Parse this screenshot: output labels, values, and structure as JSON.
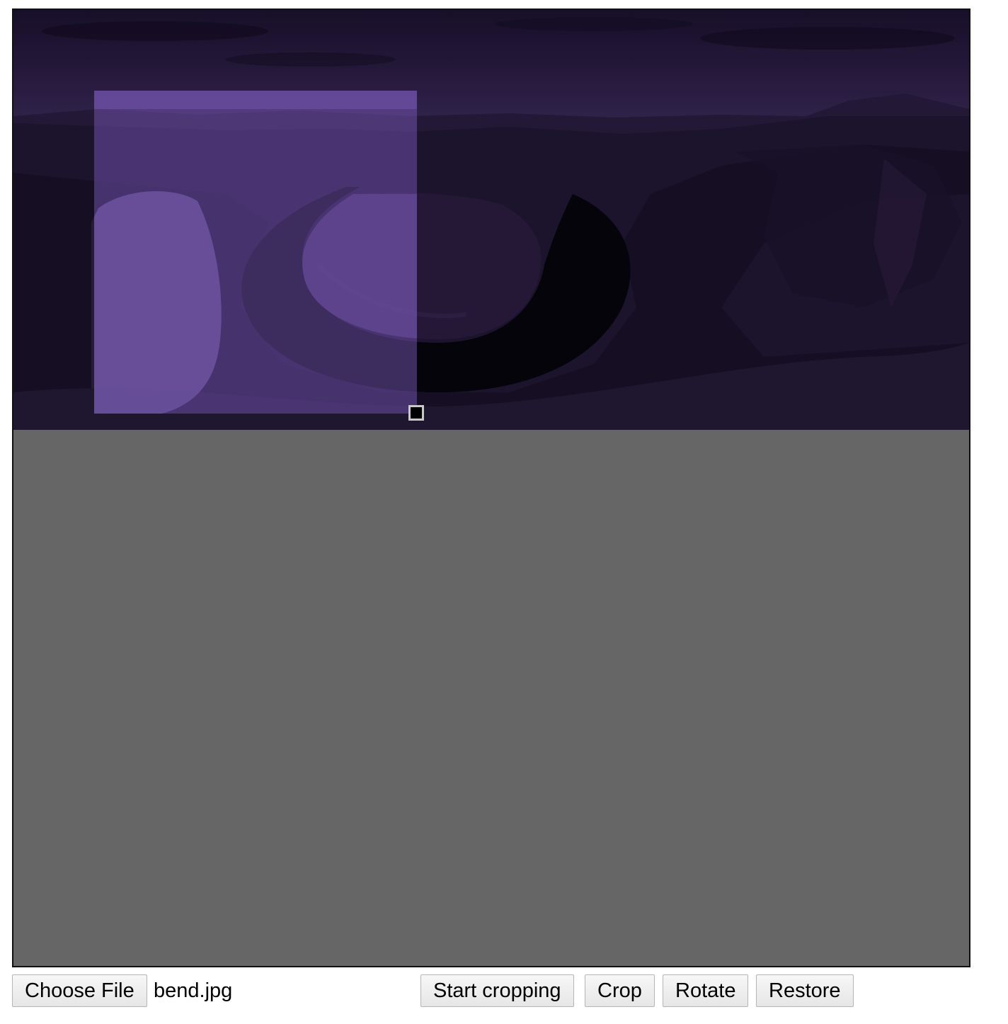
{
  "file_picker": {
    "button_label": "Choose File",
    "selected_file": "bend.jpg"
  },
  "actions": {
    "start_cropping_label": "Start cropping",
    "crop_label": "Crop",
    "rotate_label": "Rotate",
    "restore_label": "Restore"
  },
  "editor": {
    "canvas_background": "#666666",
    "image_tint": "#5a3f8e",
    "crop_handle_icon": "resize-handle-icon"
  }
}
